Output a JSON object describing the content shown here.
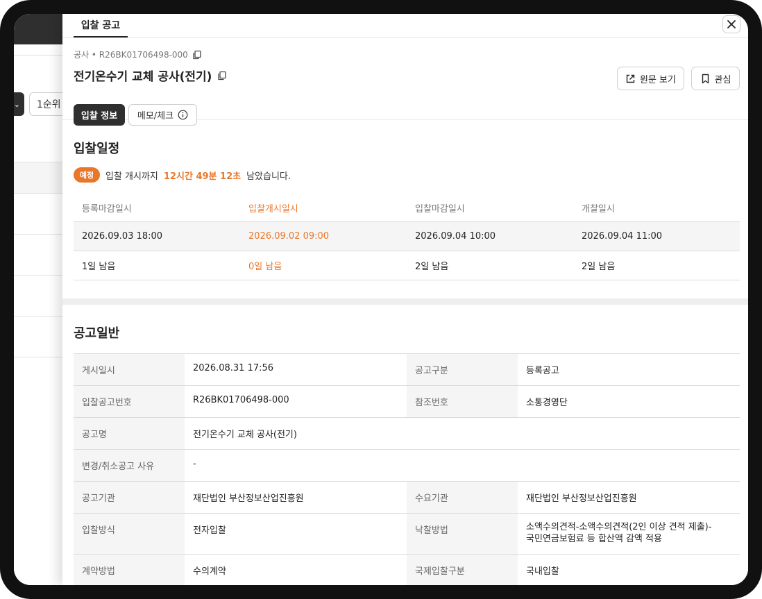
{
  "background": {
    "rank_label": "1순위"
  },
  "panel": {
    "tab_label": "입찰 공고"
  },
  "header": {
    "code": "공사 • R26BK01706498-000",
    "title": "전기온수기 교체 공사(전기)",
    "origin_button": "원문 보기",
    "favorite_button": "관심",
    "tabs": [
      {
        "label": "입찰 정보"
      },
      {
        "label": "메모/체크"
      }
    ]
  },
  "schedule": {
    "title": "입찰일정",
    "badge": "예정",
    "notice_prefix": "입찰 개시까지",
    "notice_time": "12시간 49분 12초",
    "notice_suffix": "남았습니다.",
    "columns": [
      "등록마감일시",
      "입찰개시일시",
      "입찰마감일시",
      "개찰일시"
    ],
    "dates": [
      "2026.09.03 18:00",
      "2026.09.02 09:00",
      "2026.09.04 10:00",
      "2026.09.04 11:00"
    ],
    "remaining": [
      "1일 남음",
      "0일 남음",
      "2일 남음",
      "2일 남음"
    ]
  },
  "general": {
    "title": "공고일반",
    "rows": [
      {
        "label1": "게시일시",
        "value1": "2026.08.31 17:56",
        "label2": "공고구분",
        "value2": "등록공고"
      },
      {
        "label1": "입찰공고번호",
        "value1": "R26BK01706498-000",
        "label2": "참조번호",
        "value2": "소통경영단"
      },
      {
        "label": "공고명",
        "value": "전기온수기 교체 공사(전기)"
      },
      {
        "label": "변경/취소공고 사유",
        "value": "-"
      },
      {
        "label1": "공고기관",
        "value1": "재단법인 부산정보산업진흥원",
        "label2": "수요기관",
        "value2": "재단법인 부산정보산업진흥원"
      },
      {
        "label1": "입찰방식",
        "value1": "전자입찰",
        "label2": "낙찰방법",
        "value2_line1": "소액수의견적-소액수의견적(2인 이상 견적 제출)-",
        "value2_line2": "국민연금보험료 등 합산액 감액 적용"
      },
      {
        "label1": "계약방법",
        "value1": "수의계약",
        "label2": "국제입찰구분",
        "value2": "국내입찰"
      }
    ]
  }
}
